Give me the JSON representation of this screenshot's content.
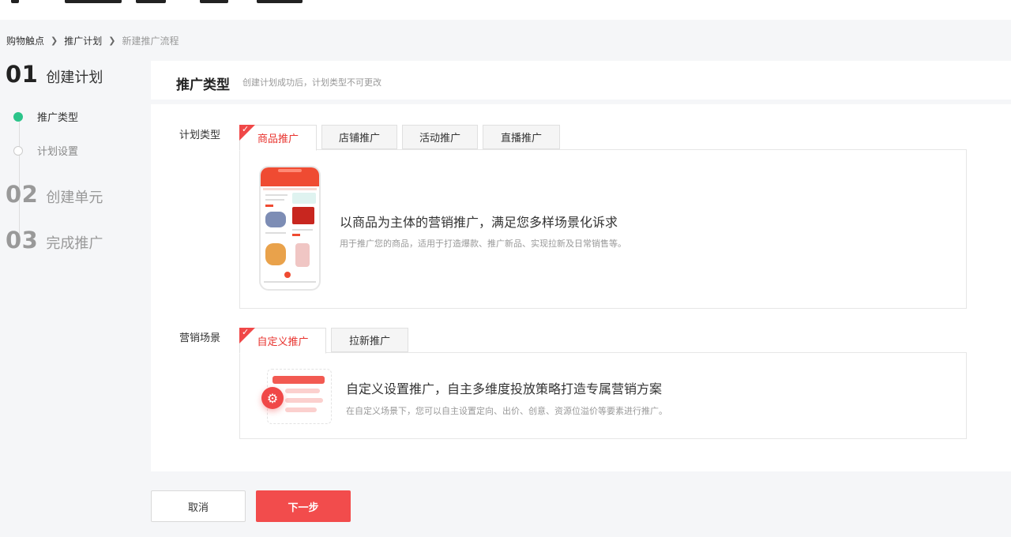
{
  "breadcrumb": [
    "购物触点",
    "推广计划",
    "新建推广流程"
  ],
  "steps": [
    {
      "num": "01",
      "title": "创建计划",
      "active": true,
      "substeps": [
        "推广类型",
        "计划设置"
      ]
    },
    {
      "num": "02",
      "title": "创建单元",
      "active": false
    },
    {
      "num": "03",
      "title": "完成推广",
      "active": false
    }
  ],
  "section": {
    "title": "推广类型",
    "note": "创建计划成功后，计划类型不可更改"
  },
  "plan_type": {
    "label": "计划类型",
    "tabs": [
      "商品推广",
      "店铺推广",
      "活动推广",
      "直播推广"
    ],
    "selected": "商品推广",
    "card": {
      "headline": "以商品为主体的营销推广，满足您多样场景化诉求",
      "desc": "用于推广您的商品，适用于打造爆款、推广新品、实现拉新及日常销售等。"
    }
  },
  "scene": {
    "label": "营销场景",
    "tabs": [
      "自定义推广",
      "拉新推广"
    ],
    "selected": "自定义推广",
    "card": {
      "headline": "自定义设置推广，自主多维度投放策略打造专属营销方案",
      "desc": "在自定义场景下，您可以自主设置定向、出价、创意、资源位溢价等要素进行推广。"
    }
  },
  "buttons": {
    "cancel": "取消",
    "next": "下一步"
  },
  "colors": {
    "accent": "#f24c4c",
    "active_step": "#2bc48a"
  }
}
